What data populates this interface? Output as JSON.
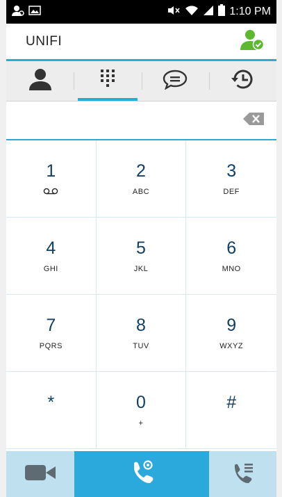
{
  "status_bar": {
    "time": "1:10 PM",
    "left_icons": [
      "user-settings-icon",
      "image-icon"
    ],
    "right_icons": [
      "mute-icon",
      "wifi-icon",
      "signal-icon",
      "battery-icon"
    ]
  },
  "app_bar": {
    "title": "UNIFI",
    "status_icon": "user-available-icon"
  },
  "tabs": [
    {
      "name": "contacts-tab",
      "icon": "person-icon",
      "active": false
    },
    {
      "name": "dialpad-tab",
      "icon": "dialpad-icon",
      "active": true
    },
    {
      "name": "messages-tab",
      "icon": "chat-bubble-icon",
      "active": false
    },
    {
      "name": "history-tab",
      "icon": "history-icon",
      "active": false
    }
  ],
  "entry": {
    "value": "",
    "backspace_icon": "backspace-icon"
  },
  "keypad": [
    {
      "digit": "1",
      "letters": "",
      "icon": "voicemail-icon"
    },
    {
      "digit": "2",
      "letters": "ABC"
    },
    {
      "digit": "3",
      "letters": "DEF"
    },
    {
      "digit": "4",
      "letters": "GHI"
    },
    {
      "digit": "5",
      "letters": "JKL"
    },
    {
      "digit": "6",
      "letters": "MNO"
    },
    {
      "digit": "7",
      "letters": "PQRS"
    },
    {
      "digit": "8",
      "letters": "TUV"
    },
    {
      "digit": "9",
      "letters": "WXYZ"
    },
    {
      "digit": "*",
      "letters": ""
    },
    {
      "digit": "0",
      "letters": "+"
    },
    {
      "digit": "#",
      "letters": ""
    }
  ],
  "bottom_bar": {
    "video_icon": "video-camera-icon",
    "call_icon": "phone-call-icon",
    "call_list_icon": "phone-list-icon"
  },
  "colors": {
    "accent": "#2ba9dc",
    "digit": "#123f63",
    "presence_green": "#5cb82e",
    "bottom_bar_bg": "#bfe0ef"
  }
}
